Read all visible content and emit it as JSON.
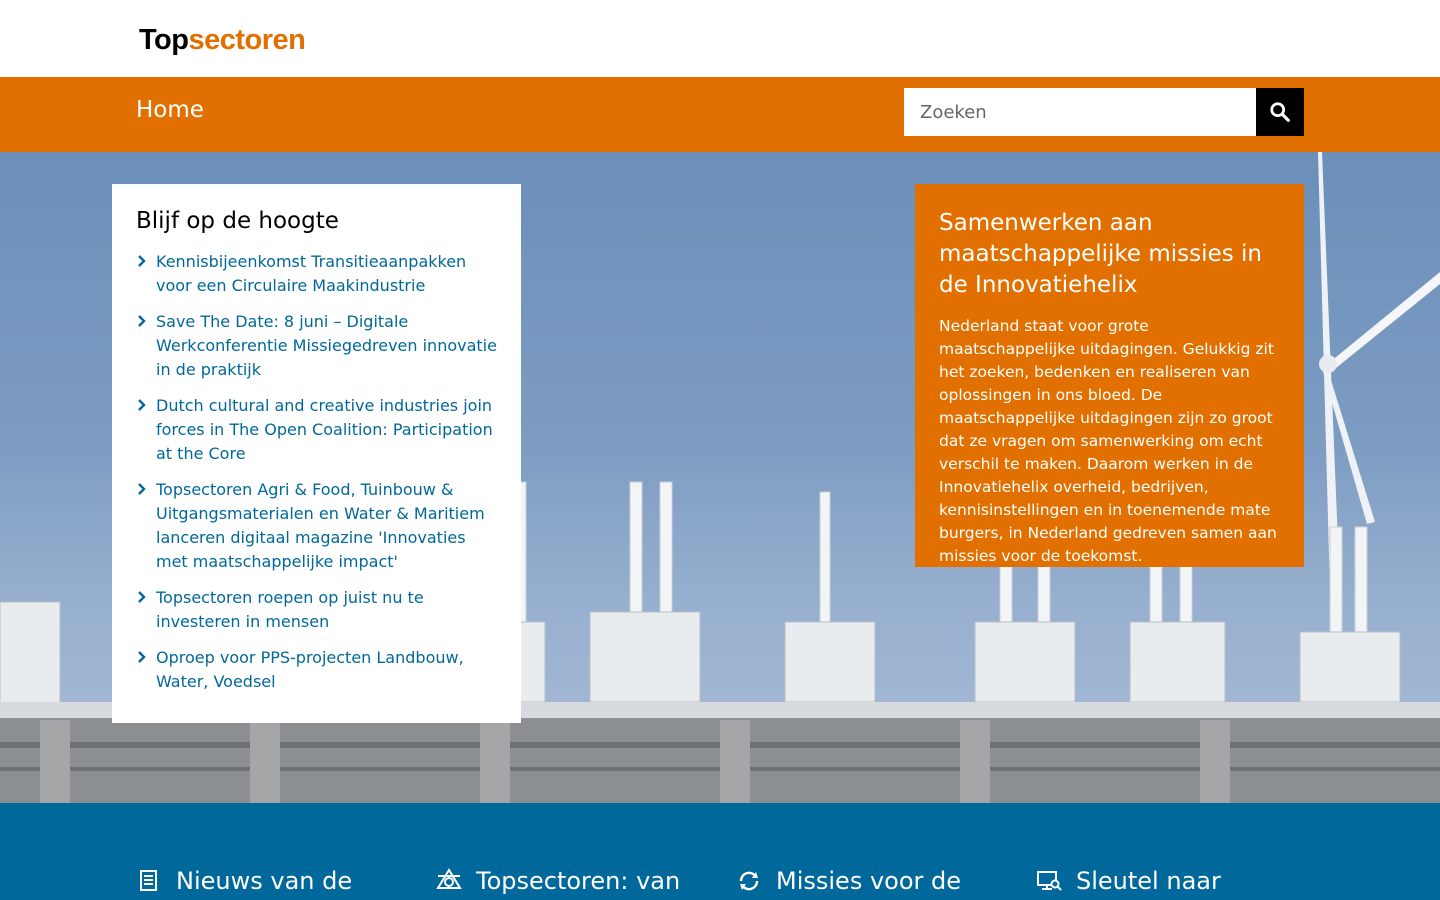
{
  "header": {
    "logo_part1": "Top",
    "logo_part2": "sectoren"
  },
  "nav": {
    "home_label": "Home",
    "search_placeholder": "Zoeken",
    "search_icon": "search-icon"
  },
  "news": {
    "title": "Blijf op de hoogte",
    "items": [
      {
        "label": "Kennisbijeenkomst Transitieaanpakken voor een Circulaire Maakindustrie"
      },
      {
        "label": "Save The Date: 8 juni – Digitale Werkconferentie Missiegedreven innovatie in de praktijk"
      },
      {
        "label": "Dutch cultural and creative industries join forces in The Open Coalition: Participation at the Core"
      },
      {
        "label": "Topsectoren Agri & Food, Tuinbouw & Uitgangsmaterialen en Water & Maritiem lanceren digitaal magazine 'Innovaties met maatschappelijke impact'"
      },
      {
        "label": "Topsectoren roepen op juist nu te investeren in mensen"
      },
      {
        "label": "Oproep voor PPS-projecten Landbouw, Water, Voedsel"
      }
    ]
  },
  "mission": {
    "title": "Samenwerken aan maatschappelijke missies in de Innovatiehelix",
    "body": "Nederland staat voor grote maatschappelijke uitdagingen. Gelukkig zit het zoeken, bedenken en realiseren van oplossingen in ons bloed. De maatschappelijke uitdagingen zijn zo groot dat ze vragen om samenwerking om echt verschil te maken. Daarom werken in de Innovatiehelix overheid, bedrijven, kennisinstellingen en in toenemende mate burgers, in Nederland gedreven samen aan missies voor de toekomst."
  },
  "features": [
    {
      "label": "Nieuws van de",
      "icon": "newspaper-icon"
    },
    {
      "label": "Topsectoren: van",
      "icon": "network-icon"
    },
    {
      "label": "Missies voor de",
      "icon": "cycle-icon"
    },
    {
      "label": "Sleutel naar",
      "icon": "monitor-search-icon"
    }
  ],
  "colors": {
    "brand_orange": "#e17000",
    "link_blue": "#01689b",
    "footer_blue": "#01689b"
  }
}
